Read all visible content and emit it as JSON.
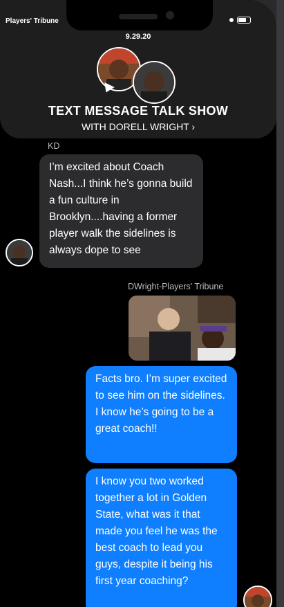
{
  "status_bar": {
    "carrier": "Players' Tribune"
  },
  "header": {
    "date": "9.29.20",
    "show_title": "TEXT MESSAGE TALK SHOW",
    "host_link": "WITH DORELL WRIGHT ›"
  },
  "messages": [
    {
      "sender": "KD",
      "text": "I’m excited about Coach Nash...I think he’s gonna build a fun culture in Brooklyn....having a former player walk the sidelines is always dope to see",
      "direction": "incoming"
    },
    {
      "sender": "DWright-Players' Tribune",
      "type": "photo",
      "direction": "outgoing"
    },
    {
      "text": "Facts bro. I’m super excited to see him on the sidelines. I know he’s going to be a great coach!!",
      "direction": "outgoing"
    },
    {
      "text": "I know you two worked together a lot in Golden State, what was it that made you feel he was the best coach to lead you guys, despite it being his first year coaching?",
      "direction": "outgoing"
    }
  ],
  "colors": {
    "outgoing_bubble": "#0f7fff",
    "incoming_bubble": "#2c2c2e",
    "background": "#000000"
  }
}
